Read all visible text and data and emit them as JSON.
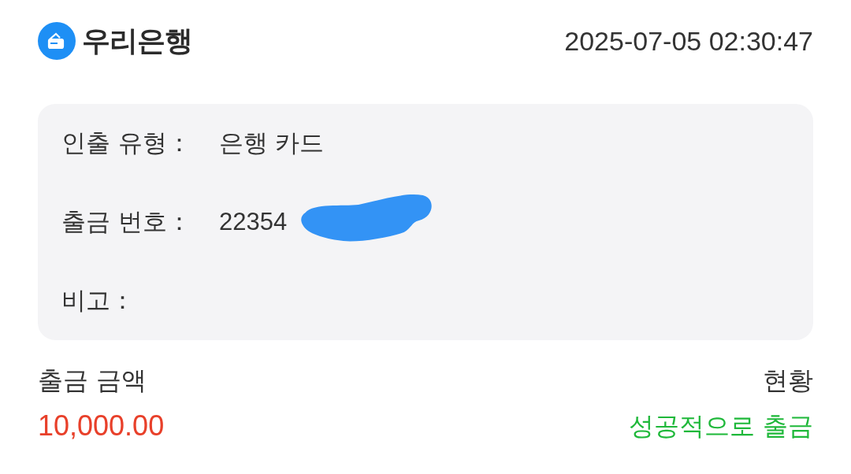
{
  "header": {
    "bank_name": "우리은행",
    "timestamp": "2025-07-05 02:30:47"
  },
  "details": [
    {
      "label": "인출 유형：",
      "value": "은행 카드",
      "redacted": false
    },
    {
      "label": "출금 번호：",
      "value": "22354",
      "redacted": true
    },
    {
      "label": "비고："
    }
  ],
  "summary": {
    "amount_label": "출금 금액",
    "amount": "10,000.00",
    "status_label": "현황",
    "status": "성공적으로 출금"
  }
}
